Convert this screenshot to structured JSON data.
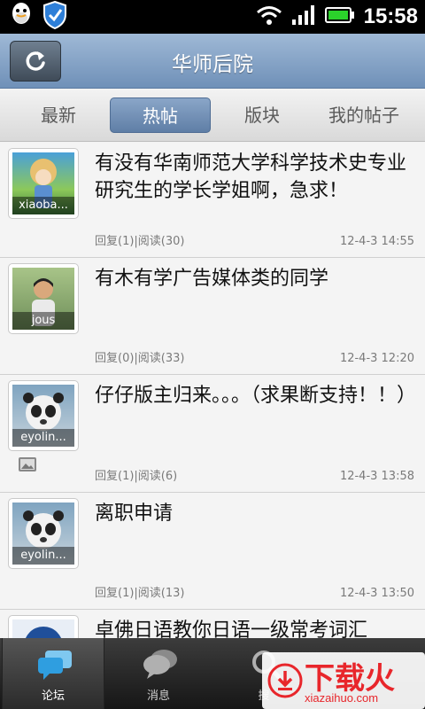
{
  "status_bar": {
    "time": "15:58"
  },
  "header": {
    "title": "华师后院"
  },
  "tabs": [
    {
      "label": "最新"
    },
    {
      "label": "热帖"
    },
    {
      "label": "版块"
    },
    {
      "label": "我的帖子"
    }
  ],
  "posts": [
    {
      "avatar_name": "xiaoba...",
      "title": "有没有华南师范大学科学技术史专业研究生的学长学姐啊，急求！",
      "meta": "回复(1)|阅读(30)",
      "time": "12-4-3 14:55"
    },
    {
      "avatar_name": "jous",
      "title": "有木有学广告媒体类的同学",
      "meta": "回复(0)|阅读(33)",
      "time": "12-4-3 12:20"
    },
    {
      "avatar_name": "eyolin...",
      "title": "仔仔版主归来。。。（求果断支持！！）",
      "meta": "回复(1)|阅读(6)",
      "time": "12-4-3 13:58"
    },
    {
      "avatar_name": "eyolin...",
      "title": "离职申请",
      "meta": "回复(1)|阅读(13)",
      "time": "12-4-3 13:50"
    },
    {
      "avatar_name": "",
      "title": "卓佛日语教你日语一级常考词汇",
      "meta": "",
      "time": ""
    }
  ],
  "bottom_nav": [
    {
      "label": "论坛"
    },
    {
      "label": "消息"
    },
    {
      "label": "搜"
    }
  ],
  "watermark": {
    "main": "下载火",
    "sub": "xiazaihuo.com"
  },
  "colors": {
    "accent": "#6f90b8",
    "tab_active": "#5f7ea6",
    "watermark": "#e8262b"
  }
}
